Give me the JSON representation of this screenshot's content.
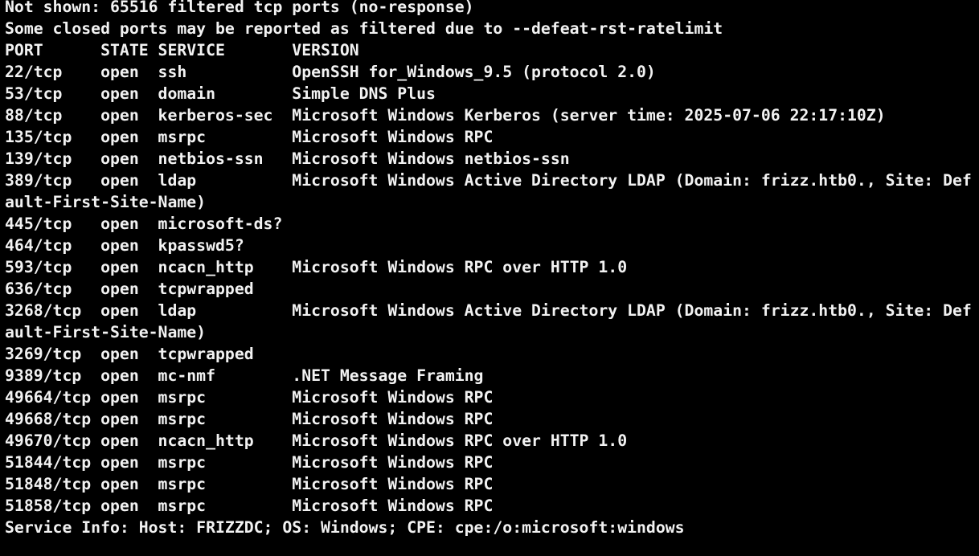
{
  "theme": {
    "background": "#000000",
    "foreground": "#f2f2f2"
  },
  "terminal": {
    "lines": [
      "Not shown: 65516 filtered tcp ports (no-response)",
      "Some closed ports may be reported as filtered due to --defeat-rst-ratelimit",
      "PORT      STATE SERVICE       VERSION",
      "22/tcp    open  ssh           OpenSSH for_Windows_9.5 (protocol 2.0)",
      "53/tcp    open  domain        Simple DNS Plus",
      "88/tcp    open  kerberos-sec  Microsoft Windows Kerberos (server time: 2025-07-06 22:17:10Z)",
      "135/tcp   open  msrpc         Microsoft Windows RPC",
      "139/tcp   open  netbios-ssn   Microsoft Windows netbios-ssn",
      "389/tcp   open  ldap          Microsoft Windows Active Directory LDAP (Domain: frizz.htb0., Site: Def",
      "ault-First-Site-Name)",
      "445/tcp   open  microsoft-ds?",
      "464/tcp   open  kpasswd5?",
      "593/tcp   open  ncacn_http    Microsoft Windows RPC over HTTP 1.0",
      "636/tcp   open  tcpwrapped",
      "3268/tcp  open  ldap          Microsoft Windows Active Directory LDAP (Domain: frizz.htb0., Site: Def",
      "ault-First-Site-Name)",
      "3269/tcp  open  tcpwrapped",
      "9389/tcp  open  mc-nmf        .NET Message Framing",
      "49664/tcp open  msrpc         Microsoft Windows RPC",
      "49668/tcp open  msrpc         Microsoft Windows RPC",
      "49670/tcp open  ncacn_http    Microsoft Windows RPC over HTTP 1.0",
      "51844/tcp open  msrpc         Microsoft Windows RPC",
      "51848/tcp open  msrpc         Microsoft Windows RPC",
      "51858/tcp open  msrpc         Microsoft Windows RPC",
      "Service Info: Host: FRIZZDC; OS: Windows; CPE: cpe:/o:microsoft:windows"
    ]
  }
}
